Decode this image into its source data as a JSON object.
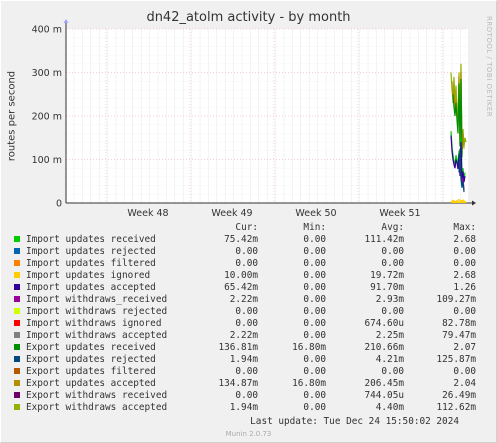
{
  "chart_data": {
    "type": "line",
    "title": "dn42_atolm activity - by month",
    "ylabel": "routes per second",
    "ylim": [
      0,
      400
    ],
    "y_unit": "m",
    "y_ticks": [
      {
        "value": 0,
        "label": "0"
      },
      {
        "value": 100,
        "label": "100 m"
      },
      {
        "value": 200,
        "label": "200 m"
      },
      {
        "value": 300,
        "label": "300 m"
      },
      {
        "value": 400,
        "label": "400 m"
      }
    ],
    "x_ticks": [
      "Week 48",
      "Week 49",
      "Week 50",
      "Week 51"
    ],
    "grid": true,
    "series": [
      {
        "name": "Import updates received",
        "color": "#00cc00",
        "cur": "75.42m",
        "min": "0.00",
        "avg": "111.42m",
        "max": "2.68"
      },
      {
        "name": "Import updates rejected",
        "color": "#0066b3",
        "cur": "0.00",
        "min": "0.00",
        "avg": "0.00",
        "max": "0.00"
      },
      {
        "name": "Import updates filtered",
        "color": "#ff8000",
        "cur": "0.00",
        "min": "0.00",
        "avg": "0.00",
        "max": "0.00"
      },
      {
        "name": "Import updates ignored",
        "color": "#ffcc00",
        "cur": "10.00m",
        "min": "0.00",
        "avg": "19.72m",
        "max": "2.68"
      },
      {
        "name": "Import updates accepted",
        "color": "#330099",
        "cur": "65.42m",
        "min": "0.00",
        "avg": "91.70m",
        "max": "1.26"
      },
      {
        "name": "Import withdraws_received",
        "color": "#990099",
        "cur": "2.22m",
        "min": "0.00",
        "avg": "2.93m",
        "max": "109.27m"
      },
      {
        "name": "Import withdraws rejected",
        "color": "#ccff00",
        "cur": "0.00",
        "min": "0.00",
        "avg": "0.00",
        "max": "0.00"
      },
      {
        "name": "Import withdraws ignored",
        "color": "#ff0000",
        "cur": "0.00",
        "min": "0.00",
        "avg": "674.60u",
        "max": "82.78m"
      },
      {
        "name": "Import withdraws accepted",
        "color": "#808080",
        "cur": "2.22m",
        "min": "0.00",
        "avg": "2.25m",
        "max": "79.47m"
      },
      {
        "name": "Export updates received",
        "color": "#008f00",
        "cur": "136.81m",
        "min": "16.80m",
        "avg": "210.66m",
        "max": "2.07"
      },
      {
        "name": "Export updates rejected",
        "color": "#00487d",
        "cur": "1.94m",
        "min": "0.00",
        "avg": "4.21m",
        "max": "125.87m"
      },
      {
        "name": "Export updates filtered",
        "color": "#b35a00",
        "cur": "0.00",
        "min": "0.00",
        "avg": "0.00",
        "max": "0.00"
      },
      {
        "name": "Export updates accepted",
        "color": "#b38f00",
        "cur": "134.87m",
        "min": "16.80m",
        "avg": "206.45m",
        "max": "2.04"
      },
      {
        "name": "Export withdraws received",
        "color": "#6b006b",
        "cur": "0.00",
        "min": "0.00",
        "avg": "744.05u",
        "max": "26.49m"
      },
      {
        "name": "Export withdraws accepted",
        "color": "#8fb300",
        "cur": "1.94m",
        "min": "0.00",
        "avg": "4.40m",
        "max": "112.62m"
      }
    ]
  },
  "legend": {
    "header_cur": "Cur:",
    "header_min": "Min:",
    "header_avg": "Avg:",
    "header_max": "Max:"
  },
  "last_update": "Last update: Tue Dec 24 15:50:02 2024",
  "watermark": "RRDTOOL / TOBI OETIKER",
  "footer": "Munin 2.0.73"
}
